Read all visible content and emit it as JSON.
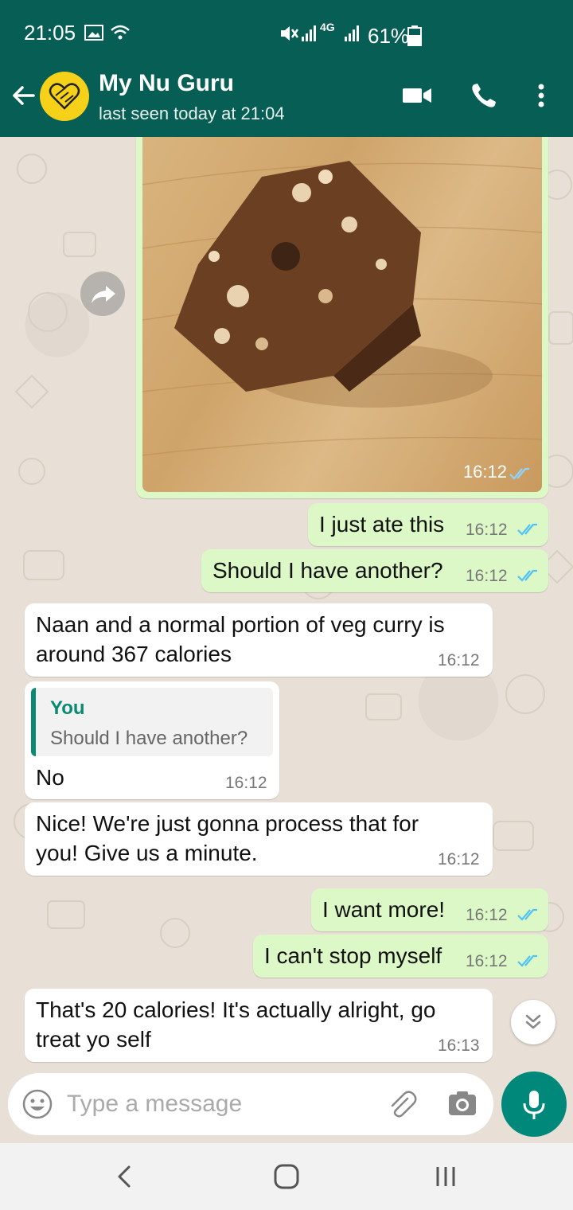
{
  "status_bar": {
    "time": "21:05",
    "battery": "61%",
    "network": "4G"
  },
  "header": {
    "contact_name": "My Nu Guru",
    "last_seen": "last seen today at 21:04"
  },
  "messages": [
    {
      "type": "image",
      "direction": "out",
      "time": "16:12"
    },
    {
      "direction": "out",
      "text": "I just ate this",
      "time": "16:12"
    },
    {
      "direction": "out",
      "text": "Should I have another?",
      "time": "16:12"
    },
    {
      "direction": "in",
      "text": "Naan and a normal portion of veg curry is around 367 calories",
      "time": "16:12"
    },
    {
      "direction": "in",
      "reply_to": {
        "author": "You",
        "text": "Should I have another?"
      },
      "text": "No",
      "time": "16:12"
    },
    {
      "direction": "in",
      "text": "Nice! We're just gonna process that for you! Give us a minute.",
      "time": "16:12"
    },
    {
      "direction": "out",
      "text": "I want more!",
      "time": "16:12"
    },
    {
      "direction": "out",
      "text": "I can't stop myself",
      "time": "16:12"
    },
    {
      "direction": "in",
      "text": "That's 20 calories! It's actually alright, go treat yo self",
      "time": "16:13"
    }
  ],
  "composer": {
    "placeholder": "Type a message"
  },
  "colors": {
    "header": "#075e54",
    "outgoing_bubble": "#dcf8c6",
    "incoming_bubble": "#ffffff",
    "accent": "#00897b",
    "read_ticks": "#4fc3f7"
  }
}
